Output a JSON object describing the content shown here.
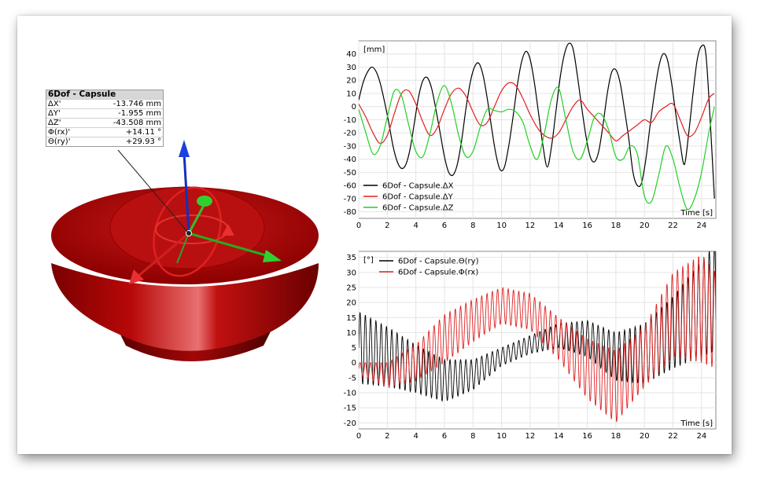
{
  "info_panel": {
    "title": "6Dof - Capsule",
    "rows": [
      {
        "label": "ΔX'",
        "value": "-13.746 mm"
      },
      {
        "label": "ΔY'",
        "value": "-1.955 mm"
      },
      {
        "label": "ΔZ'",
        "value": "-43.508 mm"
      },
      {
        "label": "Φ(rx)'",
        "value": "+14.11 °"
      },
      {
        "label": "Θ(ry)'",
        "value": "+29.93 °"
      }
    ]
  },
  "colors": {
    "capsule": "#b40000",
    "axis_x": "#22c022",
    "axis_z": "#1030c0",
    "axis_y": "#d42020"
  },
  "chart_data": [
    {
      "type": "line",
      "unit_label": "[mm]",
      "xlabel": "Time [s]",
      "xlim": [
        0,
        25
      ],
      "ylim": [
        -85,
        50
      ],
      "x_ticks": [
        0,
        2,
        4,
        6,
        8,
        10,
        12,
        14,
        16,
        18,
        20,
        22,
        24
      ],
      "y_ticks": [
        40,
        30,
        20,
        10,
        0,
        -10,
        -20,
        -30,
        -40,
        -50,
        -60,
        -70,
        -80
      ],
      "grid": true,
      "legend_position": "bottom-left",
      "series": [
        {
          "name": "6Dof - Capsule.ΔX",
          "color": "#000000",
          "x": [
            0,
            0.3,
            0.6,
            0.9,
            1.2,
            1.5,
            1.8,
            2.1,
            2.4,
            2.7,
            3.0,
            3.3,
            3.6,
            3.9,
            4.2,
            4.5,
            4.8,
            5.1,
            5.4,
            5.7,
            6.0,
            6.3,
            6.6,
            6.9,
            7.2,
            7.5,
            7.8,
            8.1,
            8.4,
            8.7,
            9.0,
            9.3,
            9.6,
            9.9,
            10.2,
            10.5,
            10.8,
            11.1,
            11.4,
            11.7,
            12.0,
            12.3,
            12.6,
            12.9,
            13.2,
            13.5,
            13.8,
            14.1,
            14.4,
            14.7,
            15.0,
            15.3,
            15.6,
            15.9,
            16.2,
            16.5,
            16.8,
            17.1,
            17.4,
            17.7,
            18.0,
            18.3,
            18.6,
            18.9,
            19.2,
            19.5,
            19.8,
            20.1,
            20.4,
            20.7,
            21.0,
            21.3,
            21.6,
            21.9,
            22.2,
            22.5,
            22.8,
            23.1,
            23.4,
            23.7,
            24.0,
            24.3,
            24.6,
            24.9
          ],
          "values": [
            5,
            18,
            26,
            30,
            27,
            18,
            4,
            -12,
            -30,
            -42,
            -47,
            -44,
            -32,
            -12,
            8,
            20,
            22,
            14,
            -2,
            -20,
            -38,
            -50,
            -52,
            -44,
            -26,
            -2,
            18,
            30,
            33,
            24,
            6,
            -16,
            -36,
            -48,
            -46,
            -30,
            -8,
            16,
            34,
            42,
            36,
            18,
            -6,
            -30,
            -46,
            -30,
            -4,
            22,
            40,
            48,
            44,
            24,
            0,
            -22,
            -38,
            -42,
            -34,
            -14,
            10,
            26,
            28,
            18,
            -2,
            -24,
            -50,
            -60,
            -58,
            -40,
            -14,
            10,
            30,
            40,
            36,
            18,
            -6,
            -28,
            -44,
            -20,
            10,
            36,
            46,
            40,
            -10,
            -70
          ]
        },
        {
          "name": "6Dof - Capsule.ΔY",
          "color": "#e02020",
          "x": [
            0,
            0.5,
            1.0,
            1.5,
            2.0,
            2.5,
            3.0,
            3.5,
            4.0,
            4.5,
            5.0,
            5.5,
            6.0,
            6.5,
            7.0,
            7.5,
            8.0,
            8.5,
            9.0,
            9.5,
            10.0,
            10.5,
            11.0,
            11.5,
            12.0,
            12.5,
            13.0,
            13.5,
            14.0,
            14.5,
            15.0,
            15.5,
            16.0,
            16.5,
            17.0,
            17.5,
            18.0,
            18.5,
            19.0,
            19.5,
            20.0,
            20.5,
            21.0,
            21.5,
            22.0,
            22.5,
            23.0,
            23.5,
            24.0,
            24.5,
            24.9
          ],
          "values": [
            2,
            -8,
            -20,
            -28,
            -22,
            -5,
            10,
            12,
            2,
            -12,
            -22,
            -16,
            -2,
            10,
            14,
            8,
            -4,
            -14,
            -12,
            0,
            12,
            18,
            16,
            6,
            -6,
            -16,
            -22,
            -24,
            -20,
            -10,
            0,
            5,
            -2,
            -8,
            -14,
            -20,
            -26,
            -22,
            -18,
            -14,
            -10,
            -12,
            -4,
            0,
            2,
            -10,
            -22,
            -20,
            -8,
            6,
            10
          ]
        },
        {
          "name": "6Dof - Capsule.ΔZ",
          "color": "#22d022",
          "x": [
            0,
            0.5,
            1.0,
            1.5,
            2.0,
            2.5,
            3.0,
            3.5,
            4.0,
            4.5,
            5.0,
            5.5,
            6.0,
            6.5,
            7.0,
            7.5,
            8.0,
            8.5,
            9.0,
            9.5,
            10.0,
            10.5,
            11.0,
            11.5,
            12.0,
            12.5,
            13.0,
            13.5,
            14.0,
            14.5,
            15.0,
            15.5,
            16.0,
            16.5,
            17.0,
            17.5,
            18.0,
            18.5,
            19.0,
            19.5,
            20.0,
            20.5,
            21.0,
            21.5,
            22.0,
            22.5,
            23.0,
            23.5,
            24.0,
            24.5,
            24.9
          ],
          "values": [
            -2,
            -20,
            -36,
            -30,
            -8,
            12,
            8,
            -14,
            -34,
            -38,
            -20,
            4,
            16,
            2,
            -22,
            -38,
            -34,
            -16,
            -2,
            -3,
            -4,
            -2,
            -4,
            -12,
            -30,
            -40,
            -20,
            6,
            14,
            -10,
            -34,
            -40,
            -26,
            -8,
            -6,
            -18,
            -38,
            -40,
            -30,
            -36,
            -68,
            -72,
            -52,
            -30,
            -40,
            -62,
            -78,
            -70,
            -50,
            -20,
            0
          ]
        }
      ]
    },
    {
      "type": "line",
      "unit_label": "[°]",
      "xlabel": "Time [s]",
      "xlim": [
        0,
        25
      ],
      "ylim": [
        -22,
        37
      ],
      "x_ticks": [
        0,
        2,
        4,
        6,
        8,
        10,
        12,
        14,
        16,
        18,
        20,
        22,
        24
      ],
      "y_ticks": [
        35,
        30,
        25,
        20,
        15,
        10,
        5,
        0,
        -5,
        -10,
        -15,
        -20
      ],
      "grid": true,
      "legend_position": "top-left",
      "series": [
        {
          "name": "6Dof - Capsule.Θ(ry)",
          "color": "#000000",
          "envelope_t": [
            0,
            2,
            4,
            6,
            8,
            10,
            12,
            14,
            16,
            18,
            20,
            22,
            24,
            25
          ],
          "center": [
            5,
            2,
            -2,
            -6,
            -4,
            2,
            6,
            9,
            8,
            2,
            3,
            10,
            18,
            22
          ],
          "amplitude": [
            12,
            10,
            8,
            7,
            5,
            3,
            3,
            4,
            6,
            8,
            10,
            12,
            16,
            18
          ],
          "frequency_hz": 2.7
        },
        {
          "name": "6Dof - Capsule.Φ(rx)",
          "color": "#e02020",
          "envelope_t": [
            0,
            2,
            4,
            6,
            8,
            10,
            12,
            14,
            16,
            18,
            20,
            22,
            24,
            25
          ],
          "center": [
            -2,
            -4,
            0,
            8,
            14,
            19,
            17,
            8,
            -2,
            -8,
            2,
            16,
            18,
            14
          ],
          "amplitude": [
            2,
            4,
            6,
            8,
            7,
            6,
            6,
            7,
            10,
            12,
            10,
            14,
            18,
            16
          ],
          "frequency_hz": 2.7
        }
      ]
    }
  ]
}
